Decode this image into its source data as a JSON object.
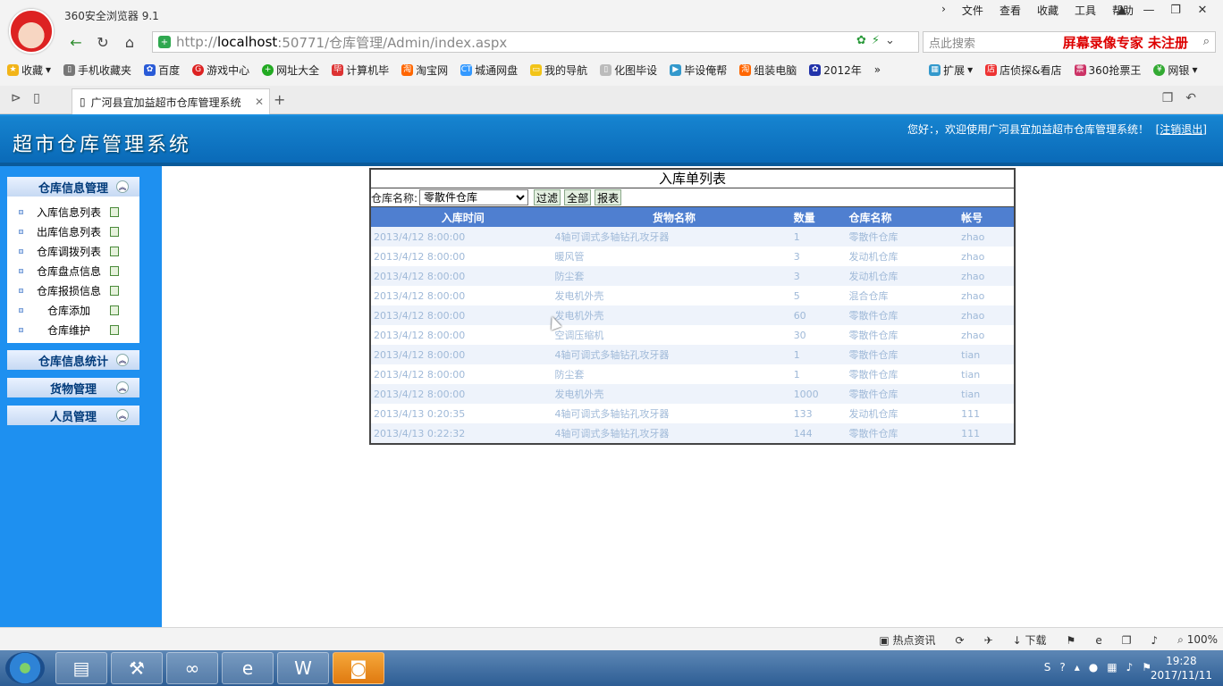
{
  "browser": {
    "app_title": "360安全浏览器 9.1",
    "menu": [
      "文件",
      "查看",
      "收藏",
      "工具",
      "帮助"
    ],
    "url_prefix": "http://",
    "url_host": "localhost",
    "url_rest": ":50771/仓库管理/Admin/index.aspx",
    "search_placeholder": "点此搜索",
    "recorder_watermark": "屏幕录像专家  未注册",
    "bookmarks": [
      "收藏",
      "手机收藏夹",
      "百度",
      "游戏中心",
      "网址大全",
      "计算机毕",
      "淘宝网",
      "城通网盘",
      "我的导航",
      "化图毕设",
      "毕设俺帮",
      "组装电脑",
      "2012年"
    ],
    "bookmarks_right": [
      "扩展",
      "店侦探&看店",
      "360抢票王",
      "网银"
    ],
    "tab_title": "广河县宜加益超市仓库管理系统"
  },
  "header": {
    "site_title": "超市仓库管理系统",
    "welcome_text": "您好：，欢迎使用广河县宜加益超市仓库管理系统！",
    "logout_label": "[注销退出]"
  },
  "sidebar": {
    "section1_title": "仓库信息管理",
    "items": [
      "入库信息列表",
      "出库信息列表",
      "仓库调拨列表",
      "仓库盘点信息",
      "仓库报损信息",
      "仓库添加",
      "仓库维护"
    ],
    "section2_title": "仓库信息统计",
    "section3_title": "货物管理",
    "section4_title": "人员管理"
  },
  "panel": {
    "title": "入库单列表",
    "filter_label": "仓库名称:",
    "selected_warehouse": "零散件仓库",
    "filter_button": "过滤",
    "all_button": "全部",
    "report_button": "报表",
    "columns": [
      "入库时间",
      "货物名称",
      "数量",
      "仓库名称",
      "帐号"
    ],
    "rows": [
      [
        "2013/4/12 8:00:00",
        "4轴可调式多轴钻孔攻牙器",
        "1",
        "零散件仓库",
        "zhao"
      ],
      [
        "2013/4/12 8:00:00",
        "暖风管",
        "3",
        "发动机仓库",
        "zhao"
      ],
      [
        "2013/4/12 8:00:00",
        "防尘套",
        "3",
        "发动机仓库",
        "zhao"
      ],
      [
        "2013/4/12 8:00:00",
        "发电机外壳",
        "5",
        "混合仓库",
        "zhao"
      ],
      [
        "2013/4/12 8:00:00",
        "发电机外壳",
        "60",
        "零散件仓库",
        "zhao"
      ],
      [
        "2013/4/12 8:00:00",
        "空调压缩机",
        "30",
        "零散件仓库",
        "zhao"
      ],
      [
        "2013/4/12 8:00:00",
        "4轴可调式多轴钻孔攻牙器",
        "1",
        "零散件仓库",
        "tian"
      ],
      [
        "2013/4/12 8:00:00",
        "防尘套",
        "1",
        "零散件仓库",
        "tian"
      ],
      [
        "2013/4/12 8:00:00",
        "发电机外壳",
        "1000",
        "零散件仓库",
        "tian"
      ],
      [
        "2013/4/13 0:20:35",
        "4轴可调式多轴钻孔攻牙器",
        "133",
        "发动机仓库",
        "111"
      ],
      [
        "2013/4/13 0:22:32",
        "4轴可调式多轴钻孔攻牙器",
        "144",
        "零散件仓库",
        "111"
      ]
    ]
  },
  "statusbar": {
    "items": [
      "热点资讯",
      "下载",
      "100%"
    ]
  },
  "taskbar": {
    "time": "19:28",
    "date": "2017/11/11"
  }
}
